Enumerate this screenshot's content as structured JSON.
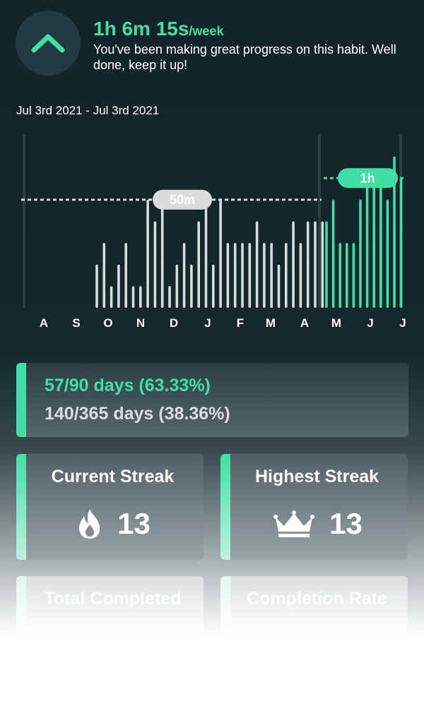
{
  "header": {
    "headline": "1h 6m 15s",
    "headline_unit": "/week",
    "description": "You've been making great progress on this habit. Well done, keep it up!"
  },
  "date_range": "Jul 3rd 2021 - Jul 3rd 2021",
  "colors": {
    "accent": "#3fe0a6",
    "bar_inactive": "#d9dcdd",
    "background": "#122428"
  },
  "chart_data": {
    "type": "bar",
    "month_labels": [
      "A",
      "S",
      "O",
      "N",
      "D",
      "J",
      "F",
      "M",
      "A",
      "M",
      "J",
      "J"
    ],
    "markers": [
      {
        "label": "50m",
        "value": 50
      },
      {
        "label": "1h",
        "value": 60
      }
    ],
    "ylim": [
      0,
      80
    ],
    "grey_values": [
      0,
      0,
      0,
      0,
      0,
      0,
      0,
      0,
      0,
      0,
      0,
      0,
      0,
      0,
      0,
      0,
      0,
      0,
      0,
      0,
      0,
      0,
      0,
      0,
      0,
      0,
      0,
      0,
      0,
      0,
      0,
      0,
      0,
      0,
      0,
      0,
      0,
      0,
      0,
      0,
      0,
      0,
      0,
      0,
      0,
      0,
      0,
      0,
      0,
      0,
      0,
      0,
      0,
      0,
      0,
      0,
      0,
      0,
      0,
      0,
      0,
      0,
      0,
      0,
      0,
      0,
      0,
      0,
      0,
      0,
      0,
      0,
      0,
      0,
      0,
      0,
      0,
      0,
      0,
      0,
      0,
      0,
      0,
      0,
      0,
      0,
      0,
      0,
      0,
      0,
      0,
      0,
      0,
      0,
      0,
      0,
      0,
      0,
      0,
      0,
      0,
      0,
      0,
      0,
      0,
      0,
      0,
      0,
      0,
      0,
      0,
      0,
      0,
      0,
      0,
      0,
      0,
      0,
      0,
      0,
      0,
      0,
      0,
      0,
      0,
      0,
      0,
      0,
      0,
      0,
      0,
      0,
      0,
      0,
      0,
      0,
      0,
      0,
      0,
      0,
      0,
      0,
      0,
      0,
      0,
      0,
      0,
      0,
      0,
      0,
      0,
      0,
      0,
      0,
      0,
      0,
      0,
      0,
      0,
      0,
      0,
      0,
      0,
      0,
      0,
      0,
      0,
      0,
      0,
      0,
      0,
      0,
      0,
      0,
      0,
      0,
      0,
      0,
      0,
      0,
      0,
      0,
      0,
      0,
      0,
      0,
      0,
      0,
      0,
      0,
      0,
      0,
      0,
      0,
      0,
      0,
      0,
      0,
      0,
      0,
      0,
      0,
      0,
      0,
      0,
      0,
      0,
      0,
      0,
      0,
      0,
      0,
      0,
      0,
      0,
      0,
      0,
      0,
      0,
      0,
      0,
      0,
      0,
      0,
      0,
      0,
      0,
      0,
      0,
      0,
      0,
      0,
      0,
      0,
      0,
      0,
      0,
      0,
      0,
      0,
      0,
      0,
      0,
      0,
      0,
      0,
      0,
      0,
      0,
      0,
      0,
      0,
      0,
      0,
      0,
      0,
      0,
      0,
      0,
      0,
      0,
      0,
      0,
      0,
      0,
      0,
      0,
      0,
      0,
      0,
      0,
      0,
      0,
      0,
      0,
      0,
      0,
      0,
      0,
      0,
      0,
      0,
      0,
      0,
      0,
      0,
      0,
      0,
      0,
      0,
      0,
      0,
      0,
      0,
      0,
      0,
      0,
      0,
      0,
      0,
      0,
      0,
      0,
      0,
      0,
      0,
      0,
      0,
      0,
      0,
      0,
      0,
      0,
      0,
      0
    ],
    "series": [
      {
        "values": [
          20,
          30,
          10,
          20,
          30,
          10,
          10,
          50,
          40,
          50,
          10,
          20,
          30,
          20,
          40,
          50,
          20,
          50,
          30,
          30,
          30,
          30,
          40,
          30,
          30,
          20,
          30,
          40,
          30,
          40,
          40,
          40
        ]
      },
      {
        "values": [
          40,
          50,
          30,
          30,
          30,
          50,
          60,
          60,
          60,
          50,
          70,
          60
        ]
      }
    ]
  },
  "stats": {
    "pct_90": "57/90 days (63.33%)",
    "pct_365": "140/365 days (38.36%)",
    "current_streak_label": "Current Streak",
    "current_streak_value": "13",
    "highest_streak_label": "Highest Streak",
    "highest_streak_value": "13",
    "total_completed_label": "Total Completed",
    "completion_rate_label": "Completion Rate"
  }
}
